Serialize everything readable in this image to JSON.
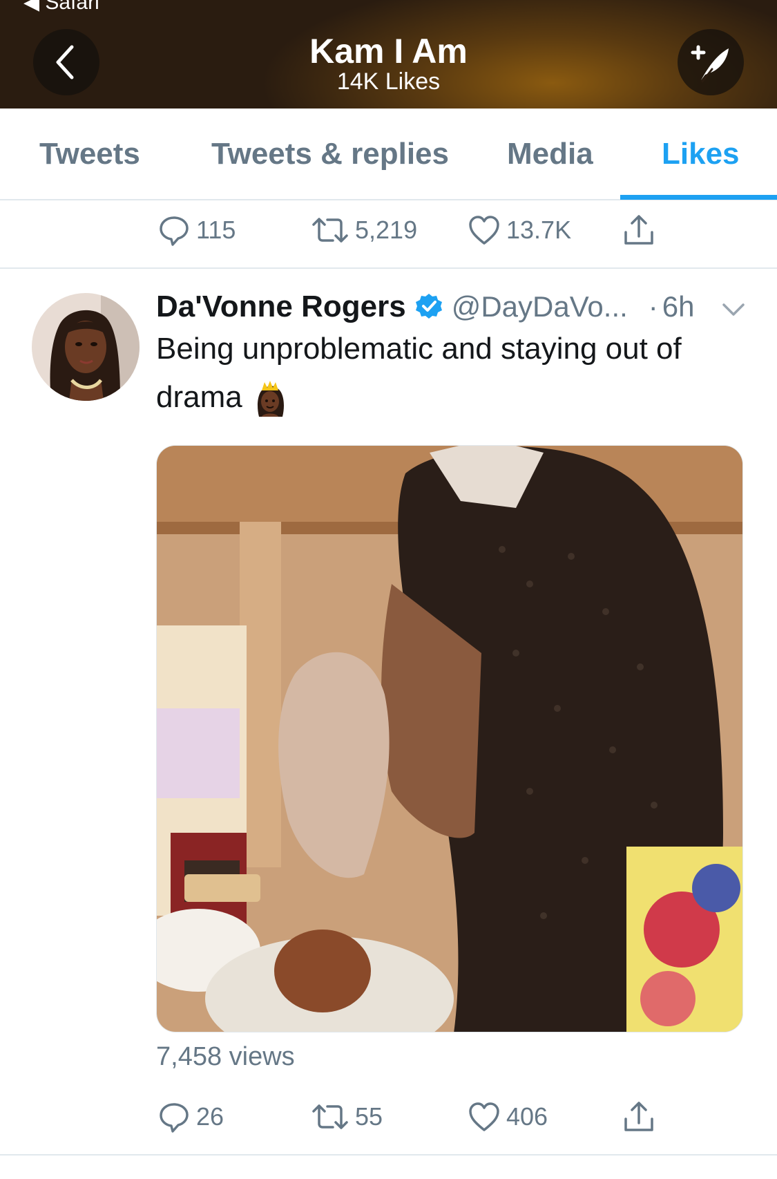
{
  "status_bar": {
    "back_app": "◀ Safari"
  },
  "header": {
    "title": "Kam I Am",
    "subtitle": "14K Likes"
  },
  "tabs": [
    {
      "label": "Tweets",
      "active": false
    },
    {
      "label": "Tweets & replies",
      "active": false
    },
    {
      "label": "Media",
      "active": false
    },
    {
      "label": "Likes",
      "active": true
    }
  ],
  "prev_tweet_actions": {
    "replies": "115",
    "retweets": "5,219",
    "likes": "13.7K"
  },
  "tweet": {
    "author_name": "Da'Vonne Rogers",
    "verified": true,
    "handle": "@DayDaVo...",
    "time_separator": "·",
    "time": "6h",
    "text": "Being unproblematic and staying out of drama",
    "emoji": "princess-emoji",
    "views": "7,458 views",
    "actions": {
      "replies": "26",
      "retweets": "55",
      "likes": "406"
    }
  },
  "colors": {
    "accent": "#1da1f2",
    "secondary_text": "#657786",
    "divider": "#e1e8ed"
  }
}
